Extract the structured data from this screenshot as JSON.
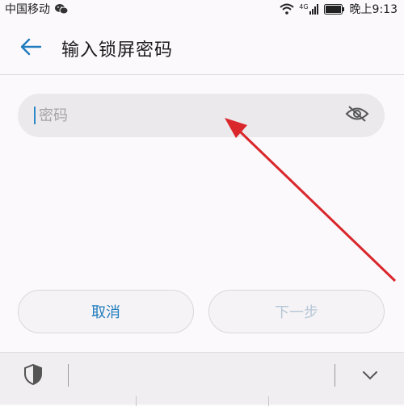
{
  "status_bar": {
    "carrier": "中国移动",
    "network": "4G",
    "time": "晚上9:13"
  },
  "header": {
    "title": "输入锁屏密码"
  },
  "password_field": {
    "placeholder": "密码",
    "value": ""
  },
  "buttons": {
    "cancel_label": "取消",
    "next_label": "下一步"
  },
  "colors": {
    "accent": "#1f7bbd",
    "disabled": "#b6c7d6",
    "annotation_arrow": "#d9272c"
  },
  "icons": [
    "wechat-icon",
    "wifi-icon",
    "signal-icon",
    "battery-icon",
    "back-arrow-icon",
    "eye-hidden-icon",
    "shield-icon",
    "chevron-down-icon"
  ]
}
